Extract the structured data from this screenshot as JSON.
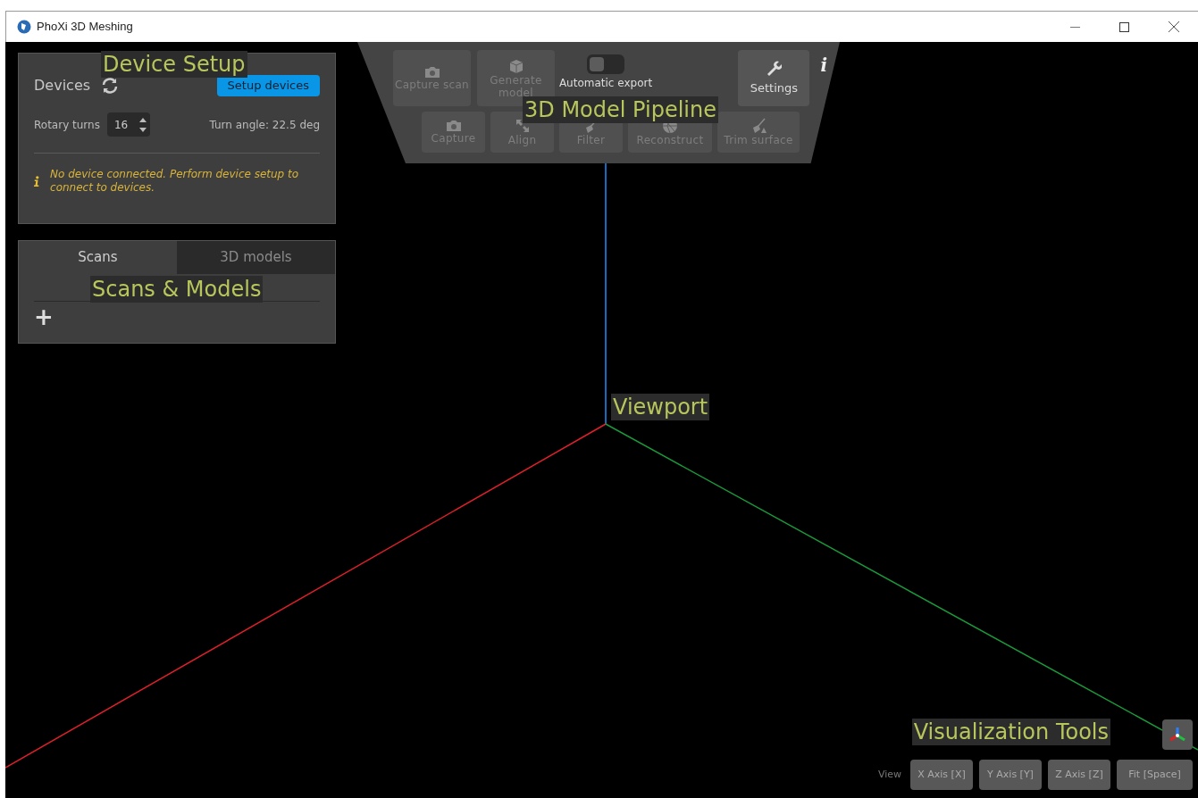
{
  "window": {
    "title": "PhoXi 3D Meshing"
  },
  "devices": {
    "annotation": "Device Setup",
    "heading": "Devices",
    "setup_button": "Setup devices",
    "rotary_label": "Rotary turns",
    "rotary_value": "16",
    "turn_angle": "Turn angle: 22.5 deg",
    "notice": "No device connected. Perform device setup to connect to devices."
  },
  "library": {
    "annotation": "Scans & Models",
    "tabs": [
      {
        "label": "Scans",
        "selected": true
      },
      {
        "label": "3D models",
        "selected": false
      }
    ],
    "add": "+"
  },
  "pipeline": {
    "annotation": "3D Model Pipeline",
    "top_buttons": [
      {
        "kind": "camera",
        "label": "Capture scan",
        "disabled": true
      },
      {
        "kind": "cube",
        "label": "Generate model",
        "disabled": true
      }
    ],
    "toggle": {
      "label": "Automatic export",
      "on": false
    },
    "settings": "Settings",
    "info": "i",
    "steps": [
      {
        "kind": "camera",
        "label": "Capture",
        "disabled": true
      },
      {
        "kind": "align",
        "label": "Align",
        "disabled": true
      },
      {
        "kind": "brush",
        "label": "Filter",
        "disabled": true
      },
      {
        "kind": "ball",
        "label": "Reconstruct",
        "disabled": true
      },
      {
        "kind": "trim",
        "label": "Trim surface",
        "disabled": true
      }
    ]
  },
  "viewport": {
    "annotation": "Viewport"
  },
  "visualization": {
    "annotation": "Visualization Tools",
    "view_label": "View",
    "buttons": [
      "X Axis [X]",
      "Y Axis [Y]",
      "Z Axis [Z]",
      "Fit [Space]"
    ]
  }
}
